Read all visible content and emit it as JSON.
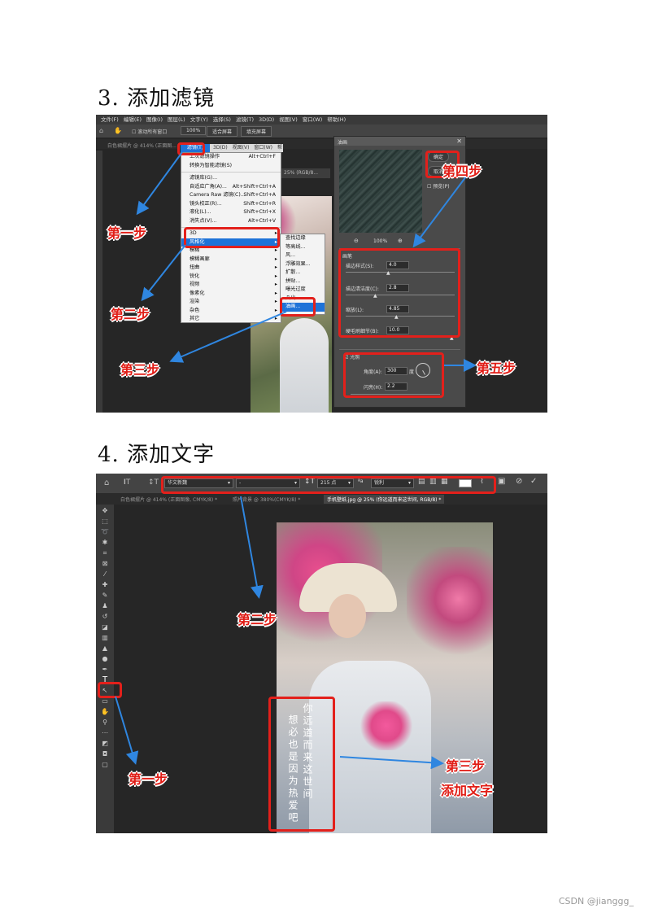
{
  "section3": {
    "heading": "3.  添加滤镜",
    "menubar": [
      "文件(F)",
      "编辑(E)",
      "图像(I)",
      "图层(L)",
      "文字(Y)",
      "选择(S)",
      "滤镜(T)",
      "3D(D)",
      "视图(V)",
      "窗口(W)",
      "帮助(H)"
    ],
    "options": {
      "scroll_all": "滚动所有窗口",
      "zoom": "100%",
      "fit_screen": "适合屏幕",
      "fill_screen": "填充屏幕"
    },
    "doc_tab": "白色裙摆片 @ 414% (正面图...",
    "filter_menu": {
      "title": "滤镜(T)",
      "small_menu": [
        "3D(D)",
        "视图(V)",
        "窗口(W)",
        "帮助(H)"
      ],
      "items": [
        {
          "label": "上次滤镜操作",
          "shortcut": "Alt+Ctrl+F"
        },
        {
          "label": "转换为智能滤镜(S)",
          "shortcut": ""
        },
        {
          "label": "滤镜库(G)...",
          "shortcut": ""
        },
        {
          "label": "自适应广角(A)...",
          "shortcut": "Alt+Shift+Ctrl+A"
        },
        {
          "label": "Camera Raw 滤镜(C)...",
          "shortcut": "Shift+Ctrl+A"
        },
        {
          "label": "镜头校正(R)...",
          "shortcut": "Shift+Ctrl+R"
        },
        {
          "label": "液化(L)...",
          "shortcut": "Shift+Ctrl+X"
        },
        {
          "label": "消失点(V)...",
          "shortcut": "Alt+Ctrl+V"
        }
      ],
      "submenus": [
        "3D",
        "风格化",
        "模糊",
        "模糊画廊",
        "扭曲",
        "锐化",
        "视频",
        "像素化",
        "渲染",
        "杂色",
        "其它"
      ],
      "stylize": [
        "查找边缘",
        "等高线...",
        "风...",
        "浮雕效果...",
        "扩散...",
        "拼贴...",
        "曝光过度",
        "凸出...",
        "油画..."
      ]
    },
    "oil_dialog": {
      "title": "油画",
      "ok": "确定",
      "cancel": "取消",
      "preview": "预览(P)",
      "zoom": "100%",
      "brush_title": "画笔",
      "params": [
        {
          "label": "描边样式(S):",
          "value": "4.0"
        },
        {
          "label": "描边清洁度(C):",
          "value": "2.8"
        },
        {
          "label": "缩放(L):",
          "value": "4.85"
        },
        {
          "label": "硬毛刷细节(B):",
          "value": "10.0"
        }
      ],
      "lighting_title": "光照",
      "angle_label": "角度(A):",
      "angle_value": "300",
      "angle_unit": "度",
      "shine_label": "闪亮(H):",
      "shine_value": "2.2"
    },
    "partial_tab": "25% (RGB/8...",
    "steps": [
      "第一步",
      "第二步",
      "第三步",
      "第四步",
      "第五步"
    ]
  },
  "section4": {
    "heading": "4.  添加文字",
    "font_family": "华文新魏",
    "font_style": "-",
    "font_size": "215 点",
    "aa": "锐利",
    "tabs": [
      "白色裙摆片 @ 414% (正面图像, CMYK/8) *",
      "照片背景 @ 380%(CMYK/8) *",
      "手机壁纸.jpg @ 25% (你远道而来这世间, RGB/8) *"
    ],
    "poem_col1": "你远道而来这世间",
    "poem_col2": "想必也是因为热爱吧",
    "steps": [
      "第一步",
      "第二步",
      "第三步",
      "添加文字"
    ]
  },
  "watermark": "CSDN @jianggg_"
}
